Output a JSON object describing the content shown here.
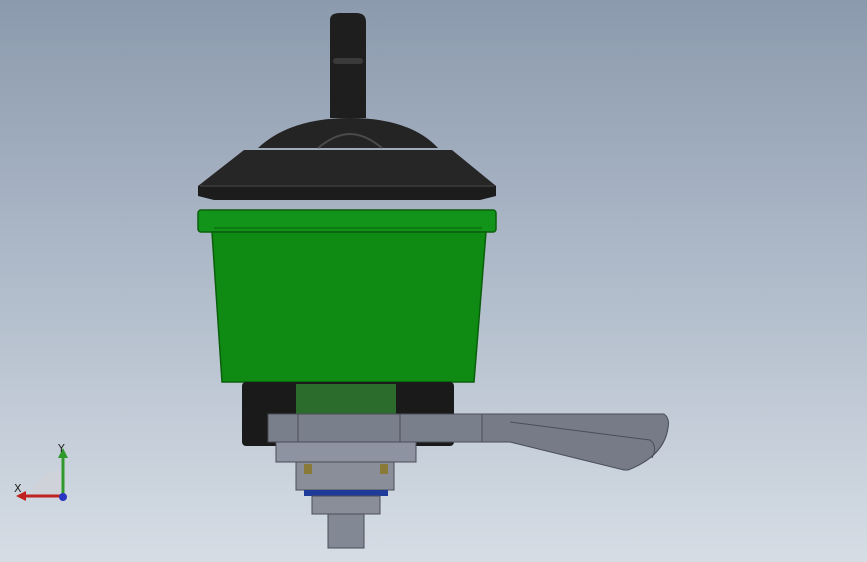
{
  "viewport": {
    "background_top": "#8c9aae",
    "background_bottom": "#d6dde5"
  },
  "model": {
    "colors": {
      "knob": "#1e1e1e",
      "knob_highlight": "#3a3a3a",
      "cap": "#262626",
      "body_green": "#0f8a12",
      "body_green_dark": "#0a6a0c",
      "base_dark": "#1a1a1a",
      "bracket": "#7a7f8c",
      "bracket_light": "#8d93a0",
      "lever": "#777b88",
      "collar": "#8a8e98",
      "ring_blue": "#1f3b9a",
      "brass": "#8a7a3a",
      "shaft": "#838895"
    }
  },
  "triad": {
    "x_label": "X",
    "y_label": "Y",
    "x_color": "#c0231f",
    "y_color": "#2f9a2b",
    "z_color": "#2a35c2",
    "x_axis_icon": "arrow-left-icon",
    "y_axis_icon": "arrow-up-icon",
    "origin_icon": "dot-icon"
  }
}
